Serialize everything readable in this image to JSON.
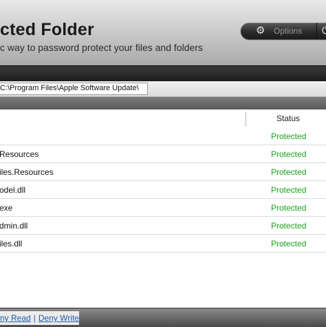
{
  "header": {
    "title": "cted Folder",
    "subtitle": "c way to password protect your files and folders",
    "options_label": "Options",
    "options_icon": "gear-icon",
    "extra_icon": "power-icon"
  },
  "path": {
    "value": "C:\\Program Files\\Apple Software Update\\"
  },
  "table": {
    "status_header": "Status",
    "rows": [
      {
        "name": "",
        "status": "Protected"
      },
      {
        "name": "Resources",
        "status": "Protected"
      },
      {
        "name": "iles.Resources",
        "status": "Protected"
      },
      {
        "name": "odel.dll",
        "status": "Protected"
      },
      {
        "name": "exe",
        "status": "Protected"
      },
      {
        "name": "dmin.dll",
        "status": "Protected"
      },
      {
        "name": "iles.dll",
        "status": "Protected"
      }
    ]
  },
  "footer": {
    "deny_read": "ny Read",
    "separator": "|",
    "deny_write": "Deny Write"
  },
  "colors": {
    "protected": "#19a019",
    "link": "#1f5aa8"
  }
}
